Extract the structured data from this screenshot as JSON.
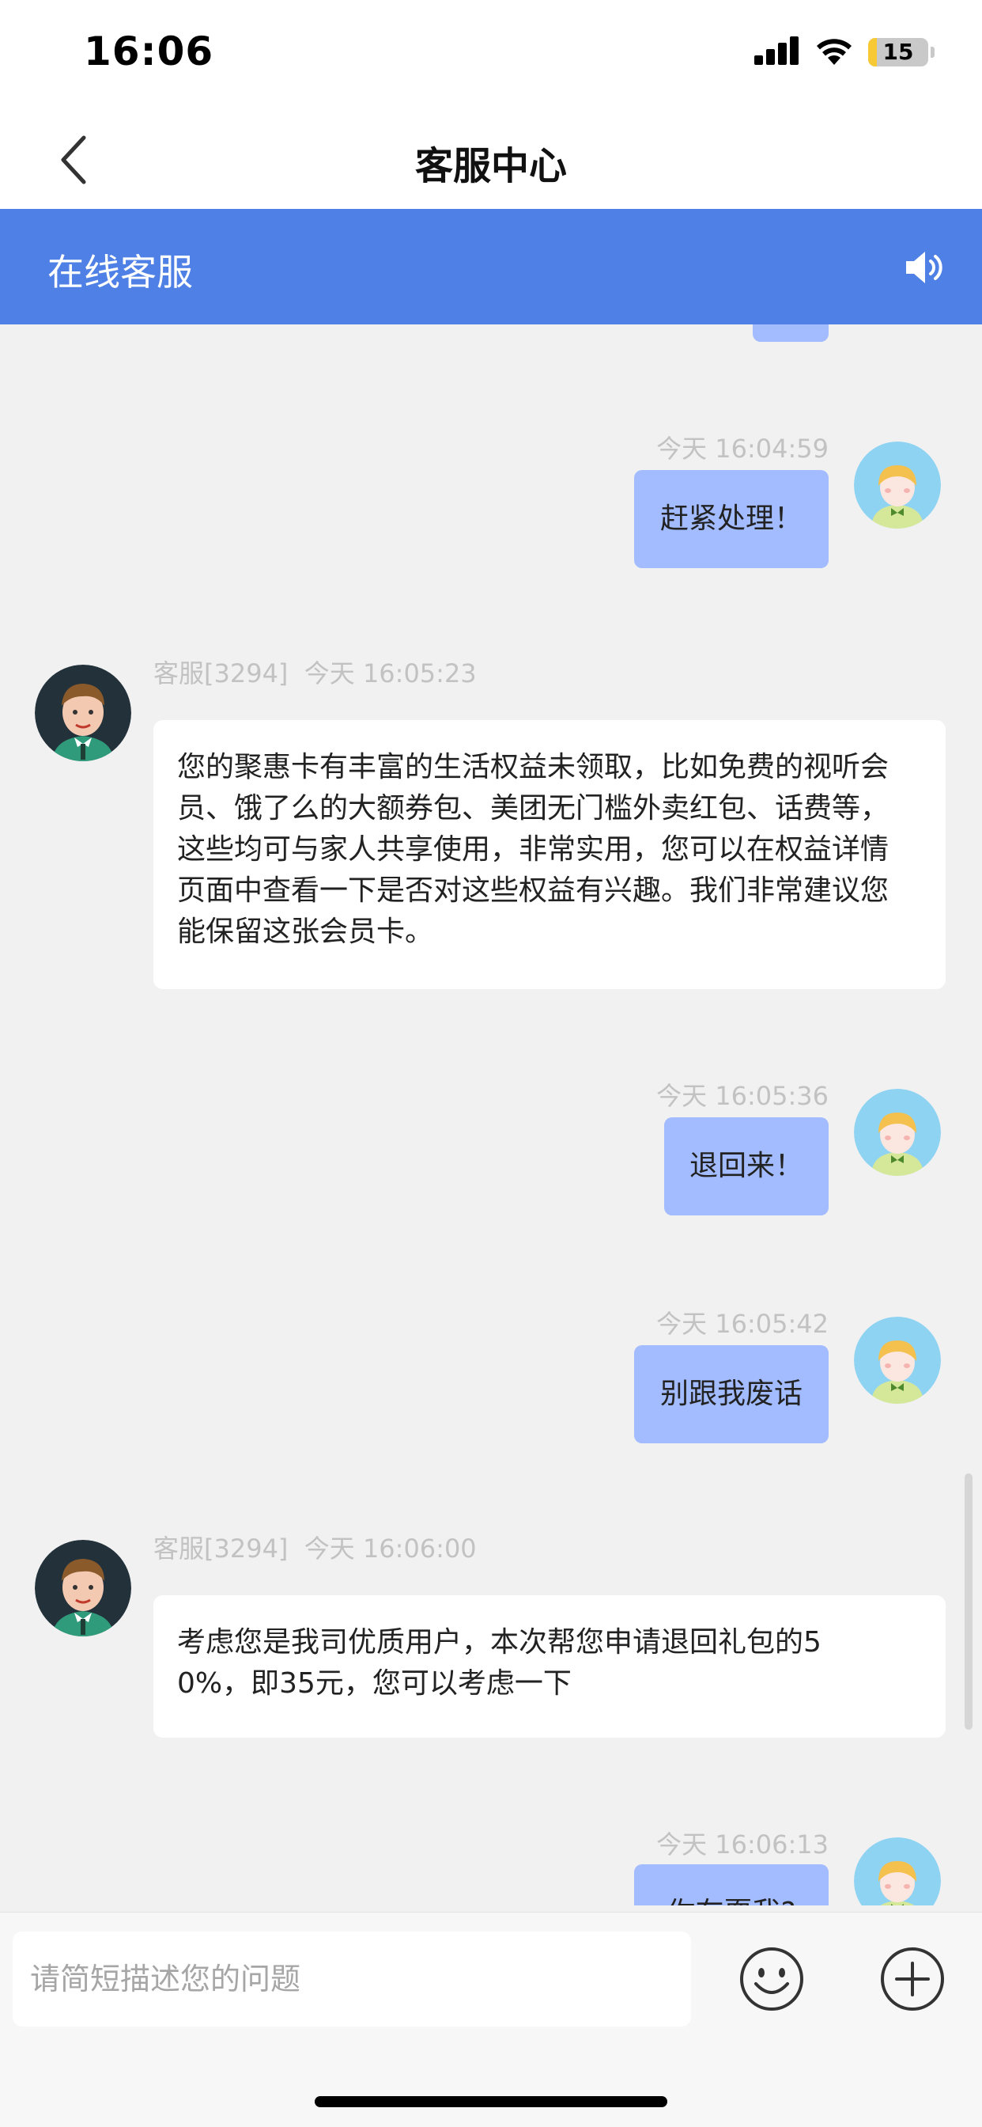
{
  "status_bar": {
    "time": "16:06",
    "battery": "15",
    "battery_level": 0.15
  },
  "nav": {
    "title": "客服中心"
  },
  "banner": {
    "title": "在线客服"
  },
  "messages": [
    {
      "sender": "user",
      "time": "今天 16:04:59",
      "text": "赶紧处理！"
    },
    {
      "sender": "agent",
      "name": "客服[3294]",
      "time": "今天 16:05:23",
      "lines": [
        "您的聚惠卡有丰富的生活权益未领取，比如免费的视听会",
        "员、饿了么的大额券包、美团无门槛外卖红包、话费等，",
        "这些均可与家人共享使用，非常实用，您可以在权益详情",
        "页面中查看一下是否对这些权益有兴趣。我们非常建议您",
        "能保留这张会员卡。"
      ]
    },
    {
      "sender": "user",
      "time": "今天 16:05:36",
      "text": "退回来！"
    },
    {
      "sender": "user",
      "time": "今天 16:05:42",
      "text": "别跟我废话"
    },
    {
      "sender": "agent",
      "name": "客服[3294]",
      "time": "今天 16:06:00",
      "lines": [
        "考虑您是我司优质用户，本次帮您申请退回礼包的5",
        "0%，即35元，您可以考虑一下"
      ]
    },
    {
      "sender": "user",
      "time": "今天 16:06:13",
      "text": "你在耍我?"
    }
  ],
  "input": {
    "placeholder": "请简短描述您的问题"
  },
  "icons": {
    "emoji": "smiley-icon",
    "plus": "plus-circle-icon",
    "speaker": "speaker-icon",
    "back": "chevron-left-icon"
  },
  "colors": {
    "banner": "#4f80e5",
    "user_bubble": "#a3bcff",
    "agent_bubble": "#ffffff"
  }
}
